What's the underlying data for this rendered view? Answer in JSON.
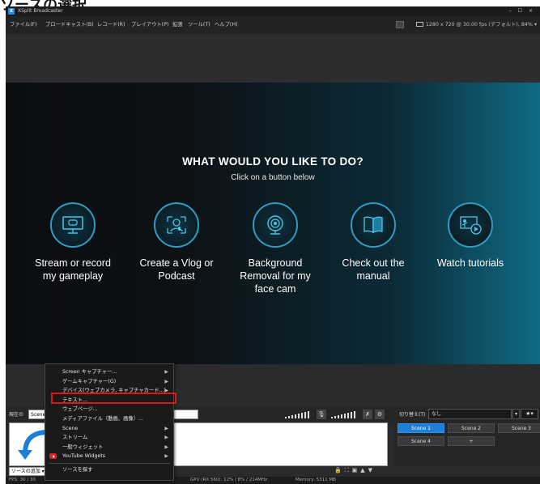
{
  "heading": "ソースの選択",
  "window": {
    "title": "XSplit Broadcaster",
    "controls": "– ☐ ×"
  },
  "menu": {
    "items": [
      "ファイル(F)",
      "ブロードキャスト(B)",
      "レコード(R)",
      "プレイアウト(P)",
      "拡張",
      "ツール(T)",
      "ヘルプ(H)"
    ],
    "resolution": "1280 x 720 @ 30.00 fps (デフォルト), 84%"
  },
  "stage": {
    "question": "WHAT WOULD YOU LIKE TO DO?",
    "subtitle": "Click on a button below",
    "options": [
      {
        "label": "Stream or record my gameplay",
        "icon": "monitor-gamepad-icon"
      },
      {
        "label": "Create a Vlog or Podcast",
        "icon": "person-mic-icon"
      },
      {
        "label": "Background Removal for my face cam",
        "icon": "webcam-icon"
      },
      {
        "label": "Check out the manual",
        "icon": "book-icon"
      },
      {
        "label": "Watch tutorials",
        "icon": "video-tutorial-icon"
      }
    ]
  },
  "controls": {
    "current_label": "現在の",
    "scene_value": "Scene 1",
    "transition_label": "切り替え(T)",
    "transition_value": "なし"
  },
  "context_menu": {
    "items": [
      {
        "label": "Screen キャプチャー...",
        "submenu": true
      },
      {
        "label": "ゲームキャプチャー(G)",
        "submenu": true
      },
      {
        "label": "デバイス(ウェブカメラ, キャプチャカード...)",
        "submenu": true
      },
      {
        "label": "テキスト...",
        "submenu": false
      },
      {
        "label": "ウェブページ...",
        "submenu": false
      },
      {
        "label": "メディアファイル（動画、画像）...",
        "submenu": false
      },
      {
        "label": "Scene",
        "submenu": true
      },
      {
        "label": "ストリーム",
        "submenu": true
      },
      {
        "label": "一般ウィジェット",
        "submenu": true
      },
      {
        "label": "YouTube Widgets",
        "submenu": true
      },
      {
        "label": "ソースを探す",
        "submenu": false
      }
    ]
  },
  "sources": {
    "add_label": "ソースの追加"
  },
  "scenes": {
    "buttons": [
      "Scene 1",
      "Scene 2",
      "Scene 3",
      "Scene 4",
      "+"
    ],
    "active": "Scene 1"
  },
  "status": {
    "fps": "FPS: 30 / 30",
    "gpu": "GPU (RX 560): 12% / 8% / 214MHz",
    "memory": "Memory: 5311 MB"
  },
  "colors": {
    "accent": "#1f7fd6",
    "highlight": "#e01515",
    "icon_ring": "#2c9ec4"
  }
}
